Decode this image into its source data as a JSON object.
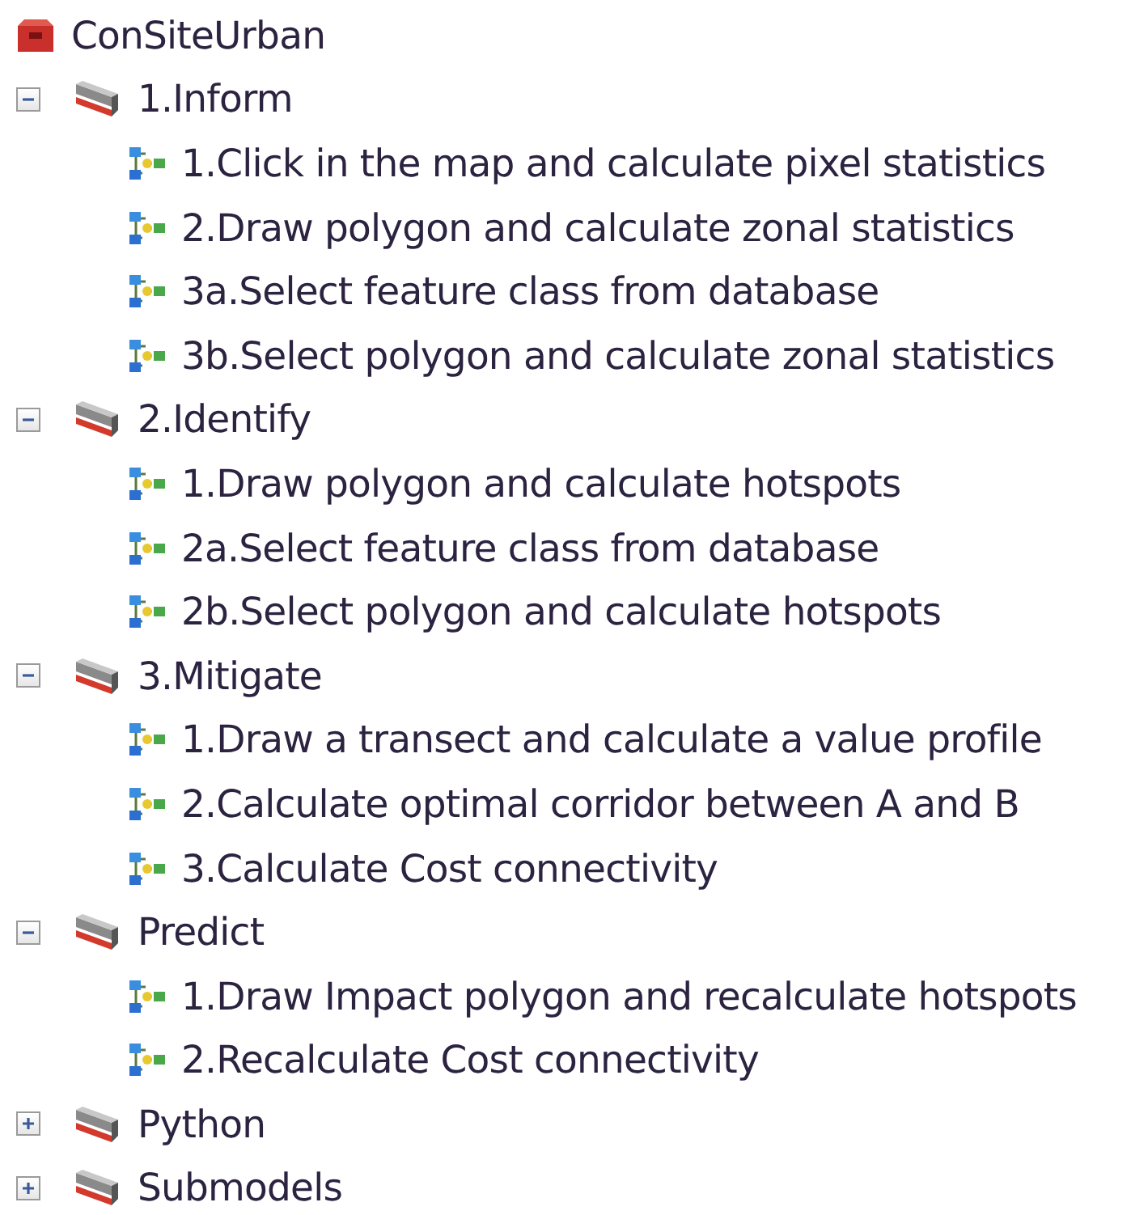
{
  "toolbox": {
    "label": "ConSiteUrban",
    "children": [
      {
        "label": "1.Inform",
        "kind": "toolset",
        "expanded": true,
        "children": [
          {
            "label": "1.Click in the map and calculate pixel statistics",
            "kind": "model"
          },
          {
            "label": "2.Draw polygon and calculate zonal statistics",
            "kind": "model"
          },
          {
            "label": "3a.Select feature class from database",
            "kind": "model"
          },
          {
            "label": "3b.Select polygon and calculate zonal statistics",
            "kind": "model"
          }
        ]
      },
      {
        "label": "2.Identify",
        "kind": "toolset",
        "expanded": true,
        "children": [
          {
            "label": "1.Draw polygon and calculate hotspots",
            "kind": "model"
          },
          {
            "label": "2a.Select feature class from database",
            "kind": "model"
          },
          {
            "label": "2b.Select polygon and calculate hotspots",
            "kind": "model"
          }
        ]
      },
      {
        "label": "3.Mitigate",
        "kind": "toolset",
        "expanded": true,
        "children": [
          {
            "label": "1.Draw a transect and calculate a value profile",
            "kind": "model"
          },
          {
            "label": "2.Calculate optimal corridor between A and B",
            "kind": "model"
          },
          {
            "label": "3.Calculate Cost connectivity",
            "kind": "model"
          }
        ]
      },
      {
        "label": "Predict",
        "kind": "toolset",
        "expanded": true,
        "children": [
          {
            "label": "1.Draw Impact polygon and recalculate hotspots",
            "kind": "model"
          },
          {
            "label": "2.Recalculate Cost connectivity",
            "kind": "model"
          }
        ]
      },
      {
        "label": "Python",
        "kind": "toolset",
        "expanded": false
      },
      {
        "label": "Submodels",
        "kind": "toolset",
        "expanded": false
      }
    ]
  }
}
